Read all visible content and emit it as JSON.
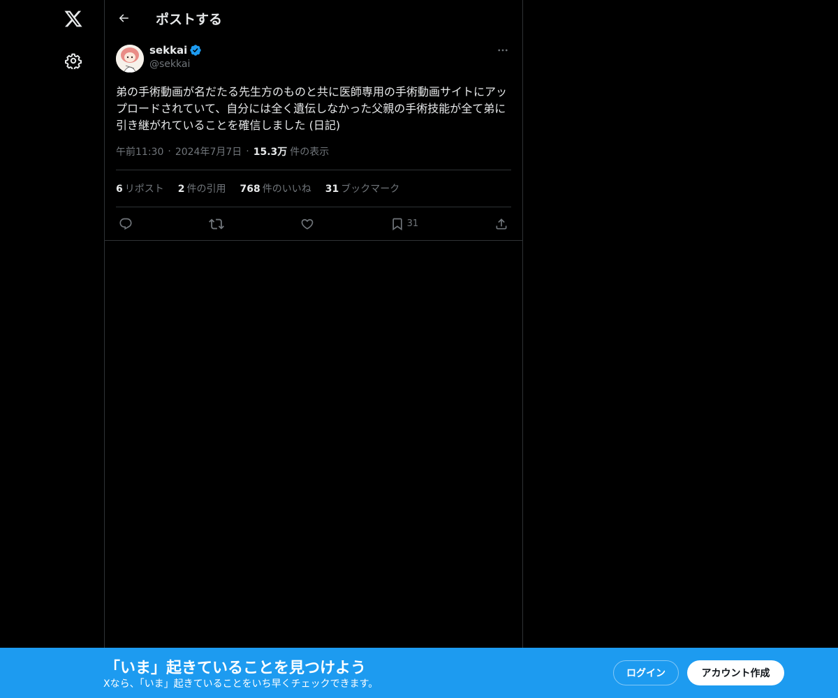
{
  "header": {
    "title": "ポストする"
  },
  "tweet": {
    "author_name": "sekkai",
    "author_handle": "@sekkai",
    "text": "弟の手術動画が名だたる先生方のものと共に医師専用の手術動画サイトにアップロードされていて、自分には全く遺伝しなかった父親の手術技能が全て弟に引き継がれていることを確信しました (日記)",
    "time": "午前11:30",
    "date": "2024年7月7日",
    "views_count": "15.3万",
    "views_label": "件の表示",
    "stats": [
      {
        "count": "6",
        "label": "リポスト"
      },
      {
        "count": "2",
        "label": "件の引用"
      },
      {
        "count": "768",
        "label": "件のいいね"
      },
      {
        "count": "31",
        "label": "ブックマーク"
      }
    ],
    "bookmark_count": "31"
  },
  "banner": {
    "title": "「いま」起きていることを見つけよう",
    "subtitle": "Xなら、「いま」起きていることをいち早くチェックできます。",
    "login_label": "ログイン",
    "signup_label": "アカウント作成"
  },
  "colors": {
    "background": "#000000",
    "text": "#e7e9ea",
    "secondary": "#71767b",
    "accent": "#1d9bf0",
    "border": "#2f3336"
  },
  "icons": [
    "x-logo-icon",
    "gear-icon",
    "back-arrow-icon",
    "verified-badge-icon",
    "more-icon",
    "reply-icon",
    "repost-icon",
    "like-icon",
    "bookmark-icon",
    "share-icon"
  ]
}
